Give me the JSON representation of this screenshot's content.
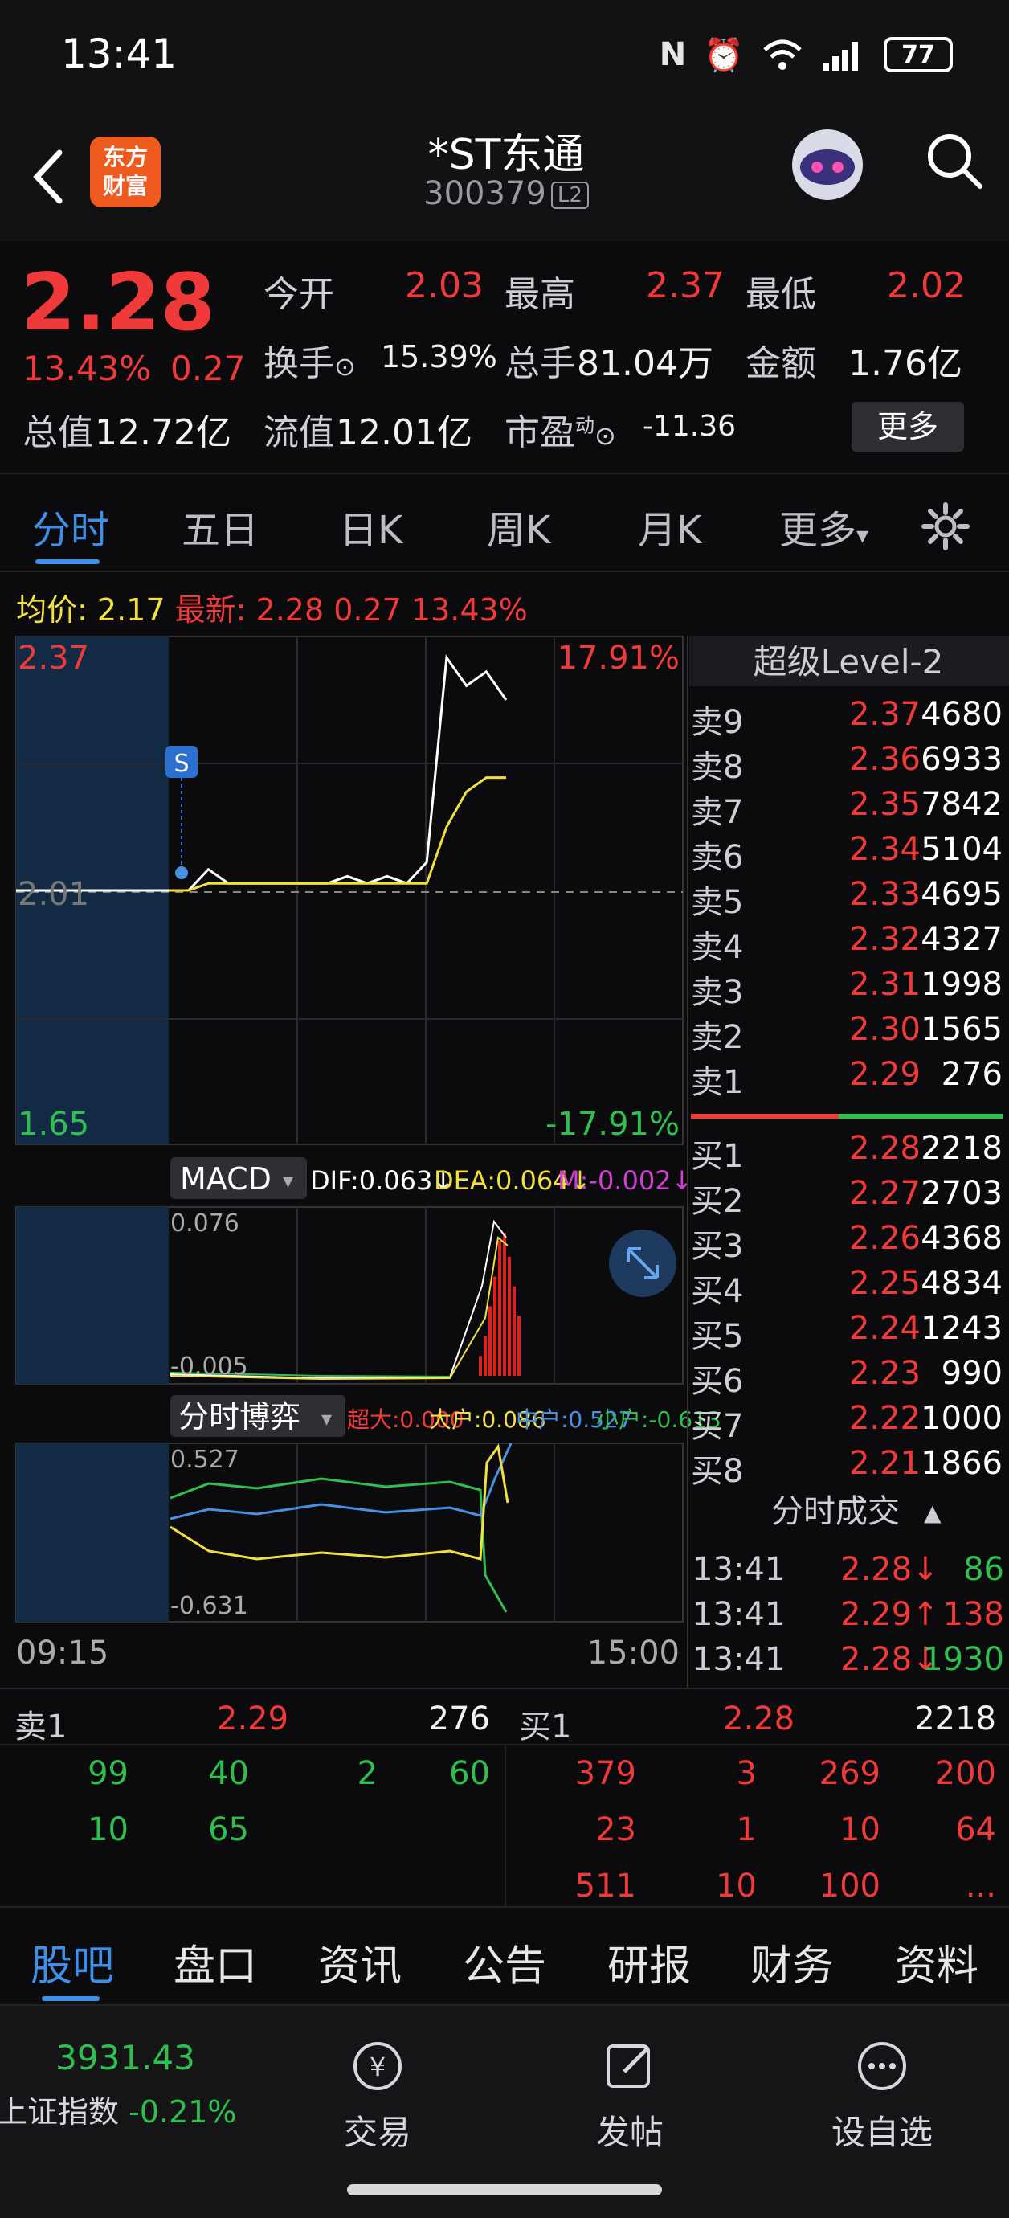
{
  "status_bar": {
    "time": "13:41",
    "battery": "77"
  },
  "header": {
    "name": "*ST东通",
    "code": "300379",
    "badge": "L2",
    "logo_text_1": "东方",
    "logo_text_2": "财富"
  },
  "quote": {
    "price": "2.28",
    "change_pct": "13.43%",
    "change_amt": "0.27",
    "open_label": "今开",
    "open": "2.03",
    "high_label": "最高",
    "high": "2.37",
    "low_label": "最低",
    "low": "2.02",
    "turnover_label": "换手",
    "turnover": "15.39%",
    "vol_label": "总手",
    "vol": "81.04万",
    "amount_label": "金额",
    "amount": "1.76亿",
    "mcap_label": "总值",
    "mcap": "12.72亿",
    "float_label": "流值",
    "float": "12.01亿",
    "pe_label": "市盈",
    "pe_sup": "动",
    "pe": "-11.36",
    "more": "更多"
  },
  "tabs": [
    "分时",
    "五日",
    "日K",
    "周K",
    "月K",
    "更多"
  ],
  "avg_info": {
    "avg_label": "均价:",
    "avg": "2.17",
    "latest_label": "最新:",
    "latest": "2.28 0.27 13.43%"
  },
  "chart_data": [
    {
      "type": "line",
      "title": "",
      "y_top": "2.37",
      "y_mid": "2.01",
      "y_bot": "1.65",
      "pct_top": "17.91%",
      "pct_bot": "-17.91%",
      "x_start": "09:15",
      "x_end": "15:00",
      "marker": "S",
      "series": [
        {
          "values": [
            2.01,
            2.01,
            2.04,
            2.02,
            2.02,
            2.02,
            2.02,
            2.02,
            2.02,
            2.03,
            2.02,
            2.03,
            2.02,
            2.05,
            2.34,
            2.3,
            2.32,
            2.28
          ]
        },
        {
          "values": [
            2.01,
            2.01,
            2.02,
            2.02,
            2.02,
            2.02,
            2.02,
            2.02,
            2.02,
            2.02,
            2.02,
            2.02,
            2.02,
            2.02,
            2.1,
            2.15,
            2.17,
            2.17
          ]
        }
      ]
    },
    {
      "type": "bar",
      "title": "MACD",
      "dif": "DIF:0.063↓",
      "dea": "DEA:0.064↓",
      "m": "M:-0.002↓",
      "y_top": "0.076",
      "y_bot": "-0.005"
    },
    {
      "type": "line",
      "title": "分时博弈",
      "super_large": "超大:0.000",
      "large": "大户:0.086",
      "mid": "中户:0.527",
      "small": "小户:-0.613",
      "y_top": "0.527",
      "y_bot": "-0.631"
    }
  ],
  "orderbook": {
    "title": "超级Level-2",
    "asks": [
      {
        "label": "卖9",
        "price": "2.37",
        "vol": "4680"
      },
      {
        "label": "卖8",
        "price": "2.36",
        "vol": "6933"
      },
      {
        "label": "卖7",
        "price": "2.35",
        "vol": "7842"
      },
      {
        "label": "卖6",
        "price": "2.34",
        "vol": "5104"
      },
      {
        "label": "卖5",
        "price": "2.33",
        "vol": "4695"
      },
      {
        "label": "卖4",
        "price": "2.32",
        "vol": "4327"
      },
      {
        "label": "卖3",
        "price": "2.31",
        "vol": "1998"
      },
      {
        "label": "卖2",
        "price": "2.30",
        "vol": "1565"
      },
      {
        "label": "卖1",
        "price": "2.29",
        "vol": "276"
      }
    ],
    "bids": [
      {
        "label": "买1",
        "price": "2.28",
        "vol": "2218"
      },
      {
        "label": "买2",
        "price": "2.27",
        "vol": "2703"
      },
      {
        "label": "买3",
        "price": "2.26",
        "vol": "4368"
      },
      {
        "label": "买4",
        "price": "2.25",
        "vol": "4834"
      },
      {
        "label": "买5",
        "price": "2.24",
        "vol": "1243"
      },
      {
        "label": "买6",
        "price": "2.23",
        "vol": "990"
      },
      {
        "label": "买7",
        "price": "2.22",
        "vol": "1000"
      },
      {
        "label": "买8",
        "price": "2.21",
        "vol": "1866"
      }
    ],
    "trades_title": "分时成交",
    "trades": [
      {
        "time": "13:41",
        "price": "2.28↓",
        "vol": "86"
      },
      {
        "time": "13:41",
        "price": "2.29↑",
        "vol": "138"
      },
      {
        "time": "13:41",
        "price": "2.28↓",
        "vol": "1930"
      }
    ]
  },
  "ticks": {
    "left_header": {
      "label": "卖1",
      "price": "2.29",
      "vol": "276"
    },
    "right_header": {
      "label": "买1",
      "price": "2.28",
      "vol": "2218"
    },
    "left_rows": [
      [
        "99",
        "40",
        "2",
        "60"
      ],
      [
        "10",
        "65"
      ]
    ],
    "right_rows": [
      [
        "379",
        "3",
        "269",
        "200"
      ],
      [
        "23",
        "1",
        "10",
        "64"
      ],
      [
        "511",
        "10",
        "100",
        "..."
      ]
    ]
  },
  "bottom_tabs": [
    "股吧",
    "盘口",
    "资讯",
    "公告",
    "研报",
    "财务",
    "资料"
  ],
  "bottom_nav": {
    "index_value": "3931.43",
    "index_label": "上证指数",
    "index_chg": "-0.21%",
    "trade": "交易",
    "post": "发帖",
    "watchlist": "设自选"
  }
}
